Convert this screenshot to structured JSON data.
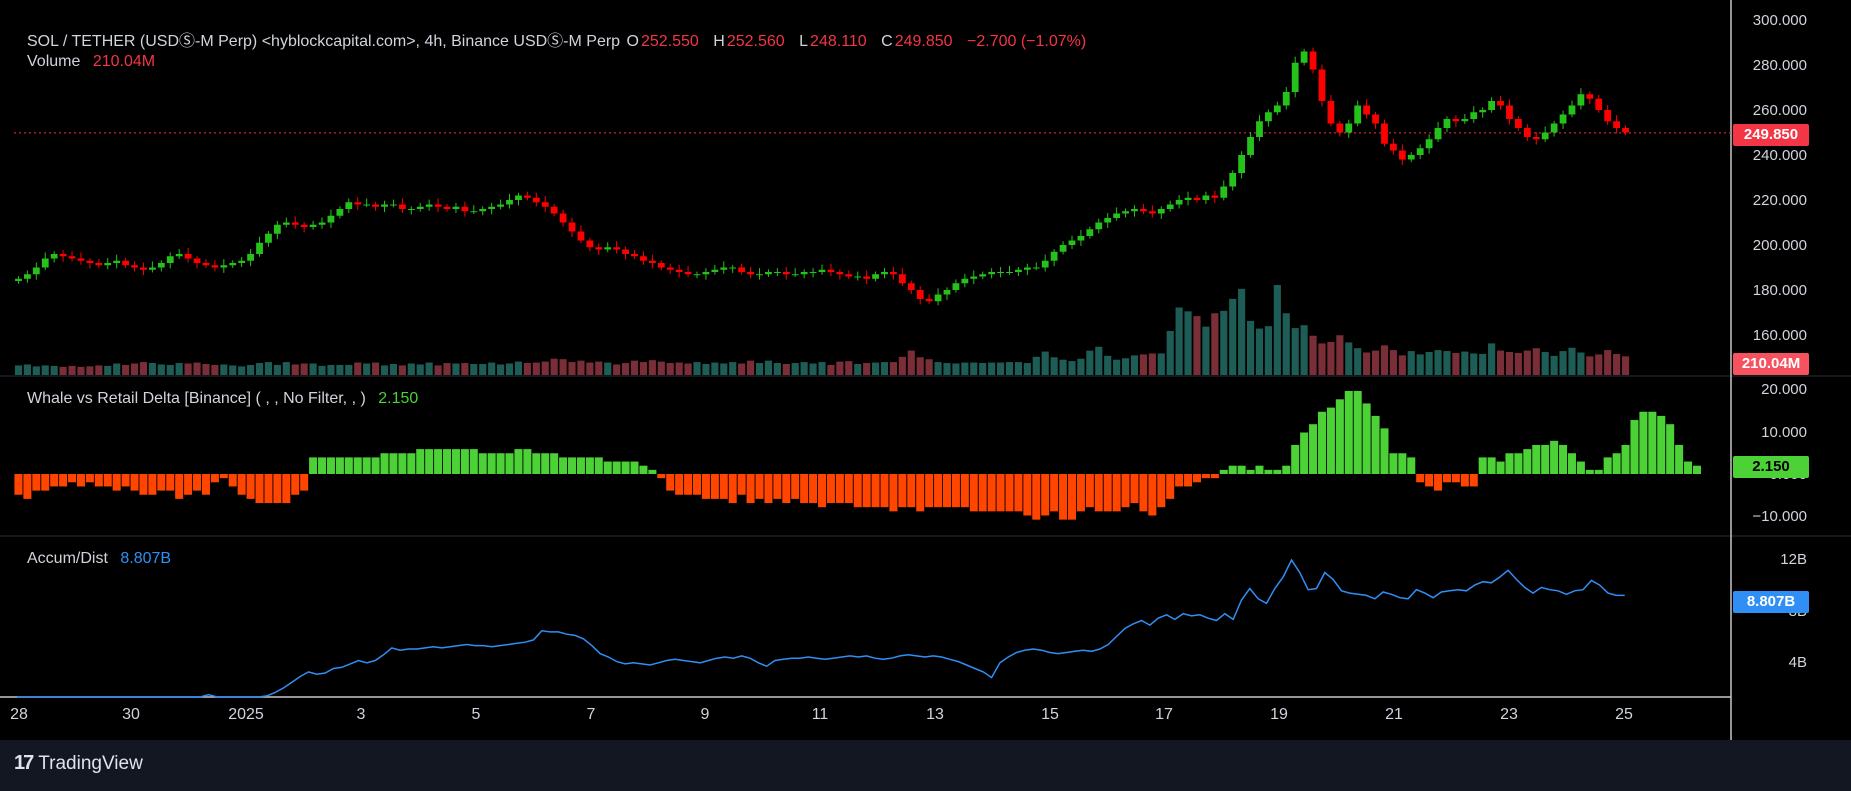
{
  "header": {
    "symbol": "SOL / TETHER (USDⓈ-M Perp) <hyblockcapital.com>, 4h, Binance USDⓈ-M Perp",
    "o_label": "O",
    "o_value": "252.550",
    "h_label": "H",
    "h_value": "252.560",
    "l_label": "L",
    "l_value": "248.110",
    "c_label": "C",
    "c_value": "249.850",
    "change": "−2.700 (−1.07%)",
    "volume_label": "Volume",
    "volume_value": "210.04M"
  },
  "panes": {
    "delta": {
      "label": "Whale vs Retail Delta [Binance] ( , , No Filter, , )",
      "value": "2.150"
    },
    "accum": {
      "label": "Accum/Dist",
      "value": "8.807B"
    }
  },
  "price_axis": [
    "300.000",
    "280.000",
    "260.000",
    "240.000",
    "220.000",
    "200.000",
    "180.000",
    "160.000"
  ],
  "delta_axis": [
    "20.000",
    "10.000",
    "0.000",
    "−10.000"
  ],
  "accum_axis": [
    "12B",
    "8B",
    "4B"
  ],
  "tags": {
    "price": "249.850",
    "volume": "210.04M",
    "delta": "2.150",
    "accum": "8.807B"
  },
  "x_axis": [
    "28",
    "30",
    "2025",
    "3",
    "5",
    "7",
    "9",
    "11",
    "13",
    "15",
    "17",
    "19",
    "21",
    "23",
    "25"
  ],
  "brand": "TradingView",
  "colors": {
    "up": "#22ab94",
    "down": "#f23645",
    "up_candle": "#26c21c",
    "down_candle": "#ff0000",
    "delta_pos": "#4cd137",
    "delta_neg": "#ff4500",
    "accum_line": "#2f8ff5",
    "bg": "#000000"
  },
  "chart_data": [
    {
      "type": "candlestick",
      "title": "SOL / TETHER (USDⓈ-M Perp), 4h",
      "ylim": [
        150,
        300
      ],
      "close_path": [
        185,
        187,
        190,
        194,
        196,
        195,
        194,
        193,
        192,
        191,
        192,
        193,
        191,
        190,
        189,
        190,
        192,
        195,
        196,
        194,
        192,
        191,
        190,
        191,
        192,
        193,
        196,
        201,
        205,
        209,
        210,
        209,
        208,
        209,
        210,
        213,
        216,
        219,
        218,
        218,
        217,
        218,
        218,
        216,
        216,
        217,
        218,
        217,
        216,
        217,
        215,
        215,
        216,
        217,
        218,
        220,
        222,
        221,
        219,
        217,
        214,
        210,
        206,
        202,
        199,
        198,
        199,
        198,
        196,
        195,
        193,
        192,
        190,
        189,
        188,
        187,
        187,
        188,
        189,
        190,
        190,
        188,
        187,
        187,
        188,
        188,
        187,
        187,
        188,
        188,
        189,
        188,
        187,
        186,
        186,
        185,
        187,
        188,
        187,
        183,
        180,
        176,
        175,
        178,
        180,
        183,
        185,
        186,
        187,
        188,
        188,
        188,
        189,
        190,
        190,
        193,
        197,
        200,
        202,
        204,
        207,
        210,
        212,
        214,
        215,
        216,
        215,
        214,
        216,
        218,
        220,
        221,
        220,
        222,
        221,
        226,
        232,
        240,
        248,
        255,
        259,
        262,
        268,
        281,
        286,
        278,
        264,
        254,
        250,
        254,
        262,
        258,
        254,
        245,
        242,
        238,
        240,
        243,
        247,
        252,
        256,
        255,
        256,
        259,
        260,
        264,
        262,
        256,
        252,
        248,
        247,
        250,
        254,
        258,
        262,
        267,
        265,
        260,
        255,
        252,
        250
      ]
    },
    {
      "type": "bar",
      "title": "Volume",
      "unit": "M",
      "values": [
        20,
        22,
        18,
        20,
        19,
        17,
        19,
        17,
        18,
        20,
        19,
        24,
        21,
        24,
        27,
        25,
        22,
        21,
        25,
        24,
        26,
        23,
        21,
        22,
        20,
        18,
        21,
        25,
        27,
        21,
        27,
        22,
        24,
        24,
        19,
        21,
        21,
        21,
        26,
        24,
        26,
        20,
        23,
        20,
        24,
        22,
        26,
        20,
        25,
        24,
        25,
        23,
        23,
        26,
        22,
        24,
        28,
        25,
        26,
        28,
        34,
        33,
        27,
        30,
        26,
        28,
        26,
        22,
        25,
        30,
        27,
        31,
        28,
        25,
        26,
        24,
        27,
        23,
        26,
        24,
        27,
        24,
        30,
        25,
        30,
        25,
        23,
        25,
        27,
        24,
        27,
        21,
        28,
        29,
        23,
        25,
        26,
        27,
        27,
        38,
        51,
        37,
        33,
        27,
        25,
        24,
        26,
        26,
        25,
        26,
        26,
        27,
        27,
        25,
        38,
        49,
        37,
        32,
        29,
        34,
        51,
        59,
        40,
        32,
        35,
        41,
        43,
        45,
        45,
        92,
        141,
        133,
        123,
        101,
        129,
        134,
        159,
        180,
        113,
        97,
        102,
        188,
        129,
        98,
        104,
        82,
        66,
        69,
        83,
        68,
        56,
        47,
        51,
        62,
        52,
        41,
        50,
        43,
        48,
        52,
        50,
        46,
        49,
        45,
        44,
        66,
        51,
        48,
        46,
        51,
        56,
        48,
        40,
        50,
        57,
        47,
        39,
        43,
        52,
        44,
        39
      ]
    },
    {
      "type": "bar",
      "title": "Whale vs Retail Delta",
      "ylim": [
        -12,
        20
      ],
      "values": [
        -5,
        -6,
        -4,
        -4,
        -3,
        -3,
        -2,
        -3,
        -2,
        -3,
        -3,
        -4,
        -3,
        -4,
        -5,
        -5,
        -4,
        -4,
        -6,
        -5,
        -4,
        -5,
        -2,
        -1,
        -3,
        -5,
        -6,
        -7,
        -7,
        -7,
        -7,
        -5,
        -4,
        4,
        4,
        4,
        4,
        4,
        4,
        4,
        4,
        5,
        5,
        5,
        5,
        6,
        6,
        6,
        6,
        6,
        6,
        6,
        5,
        5,
        5,
        5,
        6,
        6,
        5,
        5,
        5,
        4,
        4,
        4,
        4,
        4,
        3,
        3,
        3,
        3,
        2,
        1,
        -1,
        -4,
        -5,
        -5,
        -5,
        -6,
        -6,
        -6,
        -7,
        -5,
        -7,
        -6,
        -7,
        -6,
        -7,
        -6,
        -7,
        -7,
        -8,
        -7,
        -7,
        -7,
        -8,
        -8,
        -8,
        -8,
        -9,
        -8,
        -8,
        -9,
        -8,
        -8,
        -8,
        -8,
        -8,
        -9,
        -9,
        -9,
        -9,
        -9,
        -9,
        -10,
        -11,
        -10,
        -9,
        -11,
        -11,
        -9,
        -8,
        -9,
        -9,
        -9,
        -8,
        -7,
        -9,
        -10,
        -8,
        -6,
        -3,
        -3,
        -2,
        -1,
        -1,
        1,
        2,
        2,
        1,
        2,
        1,
        1,
        2,
        7,
        10,
        12,
        15,
        16,
        18,
        20,
        20,
        17,
        14,
        11,
        5,
        5,
        4,
        -2,
        -3,
        -4,
        -2,
        -2,
        -3,
        -3,
        4,
        4,
        3,
        5,
        5,
        6,
        7,
        7,
        8,
        7,
        5,
        3,
        1,
        1,
        4,
        5,
        7,
        13,
        15,
        15,
        14,
        12,
        7,
        3,
        2
      ]
    },
    {
      "type": "line",
      "title": "Accum/Dist",
      "unit": "B",
      "ylim": [
        0,
        13
      ],
      "values": [
        0,
        0,
        0,
        0,
        0,
        0,
        0,
        0,
        0,
        0,
        0,
        0,
        0,
        0,
        0,
        0,
        0,
        0,
        0,
        0,
        0,
        0,
        0,
        0.2,
        0,
        0,
        0,
        0,
        0,
        0,
        0.1,
        0.4,
        0.8,
        1.3,
        1.8,
        2.2,
        2,
        2.1,
        2.5,
        2.6,
        2.9,
        3.2,
        3,
        3.2,
        3.7,
        4.3,
        4.1,
        4.2,
        4.2,
        4.3,
        4.4,
        4.3,
        4.4,
        4.5,
        4.6,
        4.5,
        4.5,
        4.4,
        4.5,
        4.6,
        4.7,
        4.8,
        5,
        5.8,
        5.7,
        5.7,
        5.5,
        5.4,
        5.1,
        4.5,
        3.8,
        3.5,
        3.1,
        2.9,
        3,
        2.9,
        2.8,
        3,
        3.2,
        3.3,
        3.2,
        3.1,
        3,
        3.2,
        3.4,
        3.5,
        3.4,
        3.6,
        3.4,
        3,
        2.7,
        3.2,
        3.3,
        3.4,
        3.4,
        3.5,
        3.4,
        3.3,
        3.4,
        3.5,
        3.6,
        3.5,
        3.6,
        3.4,
        3.3,
        3.4,
        3.6,
        3.7,
        3.6,
        3.5,
        3.6,
        3.5,
        3.3,
        3.1,
        2.8,
        2.5,
        2.2,
        1.7,
        3,
        3.5,
        3.9,
        4.1,
        4.2,
        4.1,
        3.9,
        3.8,
        3.9,
        4,
        4.1,
        4,
        4.2,
        4.6,
        5.3,
        6,
        6.4,
        6.7,
        6.3,
        6.9,
        7.2,
        6.8,
        7.3,
        7.1,
        7.2,
        6.9,
        6.7,
        7.3,
        6.8,
        8.5,
        9.5,
        8.6,
        8.2,
        9.5,
        10.5,
        12,
        10.9,
        9.4,
        9.5,
        10.9,
        10.3,
        9.3,
        9.1,
        9,
        8.9,
        8.6,
        9.2,
        9,
        8.7,
        8.6,
        9.4,
        9.1,
        8.7,
        9.2,
        9.3,
        9.4,
        9.3,
        9.8,
        10.1,
        10,
        10.5,
        11.1,
        10.3,
        9.6,
        9.1,
        9.6,
        9.4,
        9.3,
        9,
        9.3,
        9.4,
        10.2,
        9.8,
        9.1,
        8.9,
        8.9
      ]
    }
  ]
}
